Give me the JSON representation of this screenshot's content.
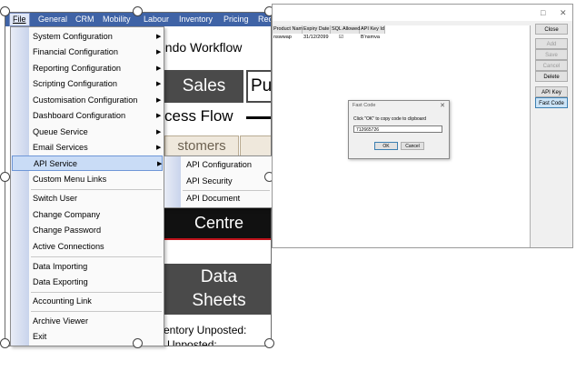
{
  "menubar": {
    "items": [
      "File",
      "General",
      "CRM",
      "Mobility",
      "Labour",
      "Inventory",
      "Pricing",
      "Req"
    ]
  },
  "background": {
    "workflow_text": "endo Workflow",
    "sales": "Sales",
    "pur": "Pur",
    "process_flow": "cess Flow",
    "customers": "stomers",
    "centre": "Centre",
    "data": "Data",
    "sheets": "Sheets",
    "inventory_unposted": "ventory Unposted:",
    "h_unposted": "h Unposted:"
  },
  "file_menu": {
    "items": [
      {
        "label": "System Configuration",
        "submenu": true
      },
      {
        "label": "Financial Configuration",
        "submenu": true
      },
      {
        "label": "Reporting Configuration",
        "submenu": true
      },
      {
        "label": "Scripting Configuration",
        "submenu": true
      },
      {
        "label": "Customisation Configuration",
        "submenu": true
      },
      {
        "label": "Dashboard Configuration",
        "submenu": true
      },
      {
        "label": "Queue Service",
        "submenu": true
      },
      {
        "label": "Email Services",
        "submenu": true
      },
      {
        "label": "API Service",
        "submenu": true,
        "highlighted": true
      },
      {
        "label": "Custom Menu Links",
        "submenu": false
      },
      {
        "label": "Switch User",
        "submenu": false
      },
      {
        "label": "Change Company",
        "submenu": false
      },
      {
        "label": "Change Password",
        "submenu": false
      },
      {
        "label": "Active Connections",
        "submenu": false
      },
      {
        "label": "Data Importing",
        "submenu": false
      },
      {
        "label": "Data Exporting",
        "submenu": false
      },
      {
        "label": "Accounting Link",
        "submenu": false
      },
      {
        "label": "Archive Viewer",
        "submenu": false
      },
      {
        "label": "Exit",
        "submenu": false
      }
    ],
    "arrow": "▶"
  },
  "api_submenu": {
    "items": [
      "API Configuration",
      "API Security",
      "API Document"
    ]
  },
  "key_window": {
    "controls": [
      "□",
      "✕"
    ],
    "columns": [
      "Product Name",
      "Expiry Date",
      "SQL Allowed",
      "API Key Id"
    ],
    "row": [
      "nswwap",
      "31/12/2099",
      "☑",
      "B'nsmva"
    ],
    "buttons": [
      {
        "label": "Close",
        "state": "normal"
      },
      {
        "label": "Add",
        "state": "disabled"
      },
      {
        "label": "Save",
        "state": "disabled"
      },
      {
        "label": "Cancel",
        "state": "disabled"
      },
      {
        "label": "Delete",
        "state": "normal"
      },
      {
        "label": "API Key",
        "state": "normal"
      },
      {
        "label": "Fast Code",
        "state": "active"
      }
    ]
  },
  "dialog": {
    "title": "Fast Code",
    "close": "✕",
    "message": "Click \"OK\" to copy code to clipboard",
    "value": "712665726",
    "ok": "OK",
    "cancel": "Cancel"
  },
  "colors": {
    "menubar": "#3f63a6",
    "highlight": "#c9dcf6",
    "tile_dark": "#4a4a4a",
    "tile_black": "#111111",
    "red_line": "#c0141c"
  }
}
